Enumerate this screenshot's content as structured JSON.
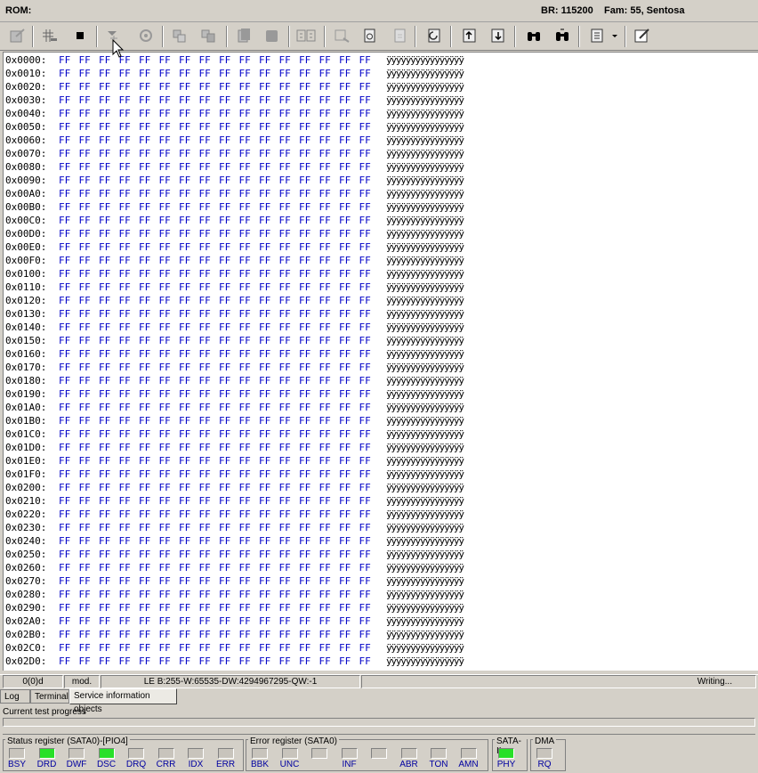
{
  "header": {
    "rom_label": "ROM:",
    "baud": "BR: 115200",
    "family": "Fam: 55, Sentosa"
  },
  "toolbar_icons": [
    "edit-icon",
    "grid-icon",
    "stop-icon",
    "marker-icon",
    "gear-icon",
    "copy-icon",
    "paste-icon",
    "page-icon",
    "save-icon",
    "compare-icon",
    "select-icon",
    "doc-icon",
    "blank-icon",
    "refresh-icon",
    "upload-icon",
    "download-icon",
    "binoculars-icon",
    "binoculars-next-icon",
    "menu-icon",
    "notepad-icon"
  ],
  "hex": {
    "addresses": [
      "0x0000:",
      "0x0010:",
      "0x0020:",
      "0x0030:",
      "0x0040:",
      "0x0050:",
      "0x0060:",
      "0x0070:",
      "0x0080:",
      "0x0090:",
      "0x00A0:",
      "0x00B0:",
      "0x00C0:",
      "0x00D0:",
      "0x00E0:",
      "0x00F0:",
      "0x0100:",
      "0x0110:",
      "0x0120:",
      "0x0130:",
      "0x0140:",
      "0x0150:",
      "0x0160:",
      "0x0170:",
      "0x0180:",
      "0x0190:",
      "0x01A0:",
      "0x01B0:",
      "0x01C0:",
      "0x01D0:",
      "0x01E0:",
      "0x01F0:",
      "0x0200:",
      "0x0210:",
      "0x0220:",
      "0x0230:",
      "0x0240:",
      "0x0250:",
      "0x0260:",
      "0x0270:",
      "0x0280:",
      "0x0290:",
      "0x02A0:",
      "0x02B0:",
      "0x02C0:",
      "0x02D0:"
    ],
    "byte_value": "FF",
    "ascii": "ÿÿÿÿÿÿÿÿÿÿÿÿÿÿÿÿ"
  },
  "statusline": {
    "position": "0(0)d",
    "mode": "mod.",
    "values": "LE B:255-W:65535-DW:4294967295-QW:-1",
    "state": "Writing..."
  },
  "tabs": [
    "Log",
    "Terminal",
    "Service information objects"
  ],
  "progress": {
    "label": "Current test progress"
  },
  "registers": {
    "status": {
      "title": "Status register (SATA0)-[PIO4]",
      "leds": [
        {
          "label": "BSY",
          "on": false
        },
        {
          "label": "DRD",
          "on": true
        },
        {
          "label": "DWF",
          "on": false
        },
        {
          "label": "DSC",
          "on": true
        },
        {
          "label": "DRQ",
          "on": false
        },
        {
          "label": "CRR",
          "on": false
        },
        {
          "label": "IDX",
          "on": false
        },
        {
          "label": "ERR",
          "on": false
        }
      ]
    },
    "error": {
      "title": "Error register (SATA0)",
      "leds": [
        {
          "label": "BBK",
          "on": false
        },
        {
          "label": "UNC",
          "on": false
        },
        {
          "label": "",
          "on": false
        },
        {
          "label": "INF",
          "on": false
        },
        {
          "label": "",
          "on": false
        },
        {
          "label": "ABR",
          "on": false
        },
        {
          "label": "TON",
          "on": false
        },
        {
          "label": "AMN",
          "on": false
        }
      ]
    },
    "sata": {
      "title": "SATA-II",
      "leds": [
        {
          "label": "PHY",
          "on": true
        }
      ]
    },
    "dma": {
      "title": "DMA",
      "leds": [
        {
          "label": "RQ",
          "on": false
        }
      ]
    }
  }
}
